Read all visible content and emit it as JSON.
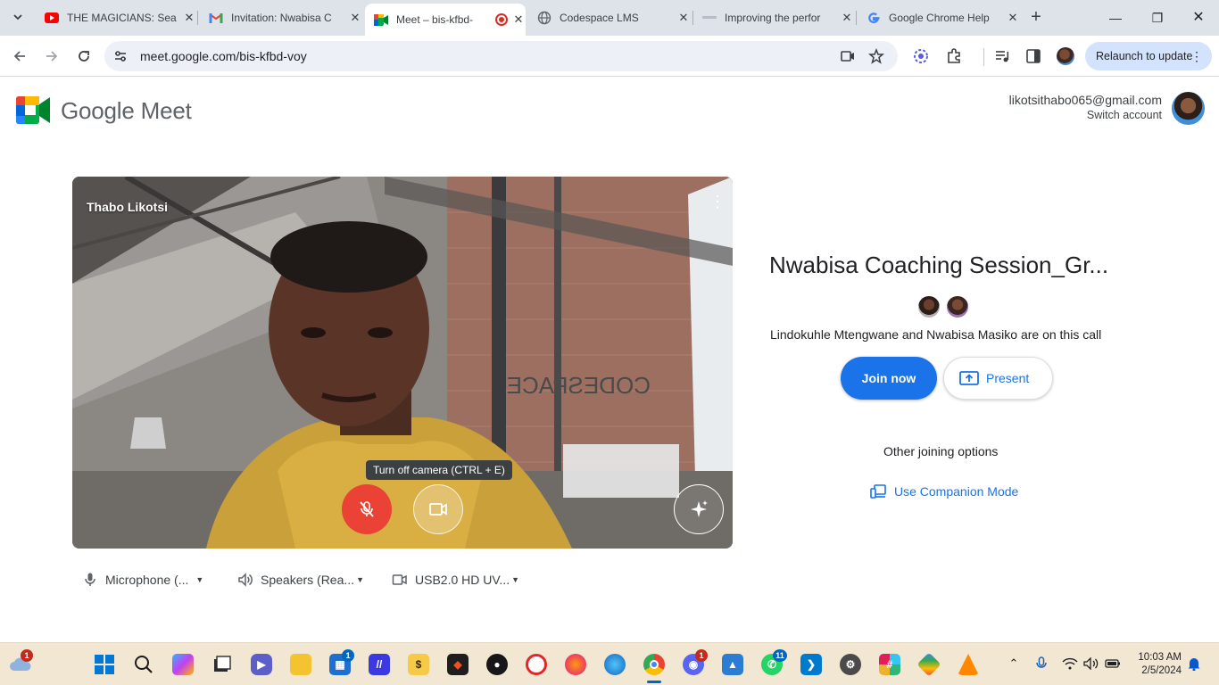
{
  "browser": {
    "tabs": [
      {
        "title": "THE MAGICIANS: Sea",
        "icon": "youtube-icon",
        "active": false
      },
      {
        "title": "Invitation: Nwabisa C",
        "icon": "gmail-icon",
        "active": false
      },
      {
        "title": "Meet – bis-kfbd-",
        "icon": "meet-icon",
        "active": true,
        "recording": true
      },
      {
        "title": "Codespace LMS",
        "icon": "globe-icon",
        "active": false
      },
      {
        "title": "Improving the perfor",
        "icon": "doc-icon",
        "active": false
      },
      {
        "title": "Google Chrome Help",
        "icon": "google-icon",
        "active": false
      }
    ],
    "url": "meet.google.com/bis-kfbd-voy",
    "relaunch_label": "Relaunch to update"
  },
  "meet": {
    "brand": "Google Meet",
    "account_email": "likotsithabo065@gmail.com",
    "switch_account": "Switch account",
    "self_name": "Thabo Likotsi",
    "camera_tooltip": "Turn off camera (CTRL + E)",
    "devices": {
      "microphone": "Microphone (...",
      "speakers": "Speakers (Rea...",
      "camera": "USB2.0 HD UV..."
    },
    "meeting_title": "Nwabisa Coaching Session_Gr...",
    "on_call": "Lindokuhle Mtengwane and Nwabisa Masiko are on this call",
    "join_label": "Join now",
    "present_label": "Present",
    "other_options": "Other joining options",
    "companion_label": "Use Companion Mode",
    "accent": "#1a73e8",
    "mic_off_color": "#ea4335"
  },
  "taskbar": {
    "weather_badge": "1",
    "store_badge": "1",
    "discord_badge": "1",
    "whatsapp_badge": "11",
    "time": "10:03 AM",
    "date": "2/5/2024"
  }
}
